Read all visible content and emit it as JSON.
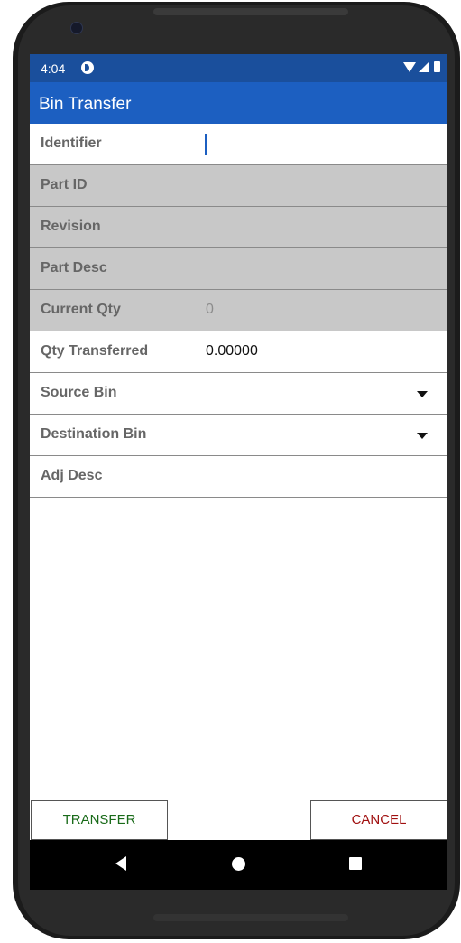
{
  "status": {
    "time": "4:04"
  },
  "appbar": {
    "title": "Bin Transfer"
  },
  "form": {
    "identifier": {
      "label": "Identifier",
      "value": ""
    },
    "part_id": {
      "label": "Part ID",
      "value": ""
    },
    "revision": {
      "label": "Revision",
      "value": ""
    },
    "part_desc": {
      "label": "Part Desc",
      "value": ""
    },
    "current_qty": {
      "label": "Current Qty",
      "value": "0"
    },
    "qty_transferred": {
      "label": "Qty Transferred",
      "value": "0.00000"
    },
    "source_bin": {
      "label": "Source Bin",
      "value": ""
    },
    "destination_bin": {
      "label": "Destination Bin",
      "value": ""
    },
    "adj_desc": {
      "label": "Adj Desc",
      "value": ""
    }
  },
  "buttons": {
    "transfer": "TRANSFER",
    "cancel": "CANCEL"
  },
  "colors": {
    "appbar": "#1c5fc1",
    "statusbar": "#1a4f9c",
    "disabled_row": "#c8c8c8",
    "transfer_text": "#1a6b1a",
    "cancel_text": "#a01010"
  },
  "icons": {
    "status": [
      "app-notification-icon",
      "wifi-icon",
      "signal-icon",
      "battery-icon"
    ],
    "nav": [
      "back-icon",
      "home-icon",
      "recents-icon"
    ]
  }
}
